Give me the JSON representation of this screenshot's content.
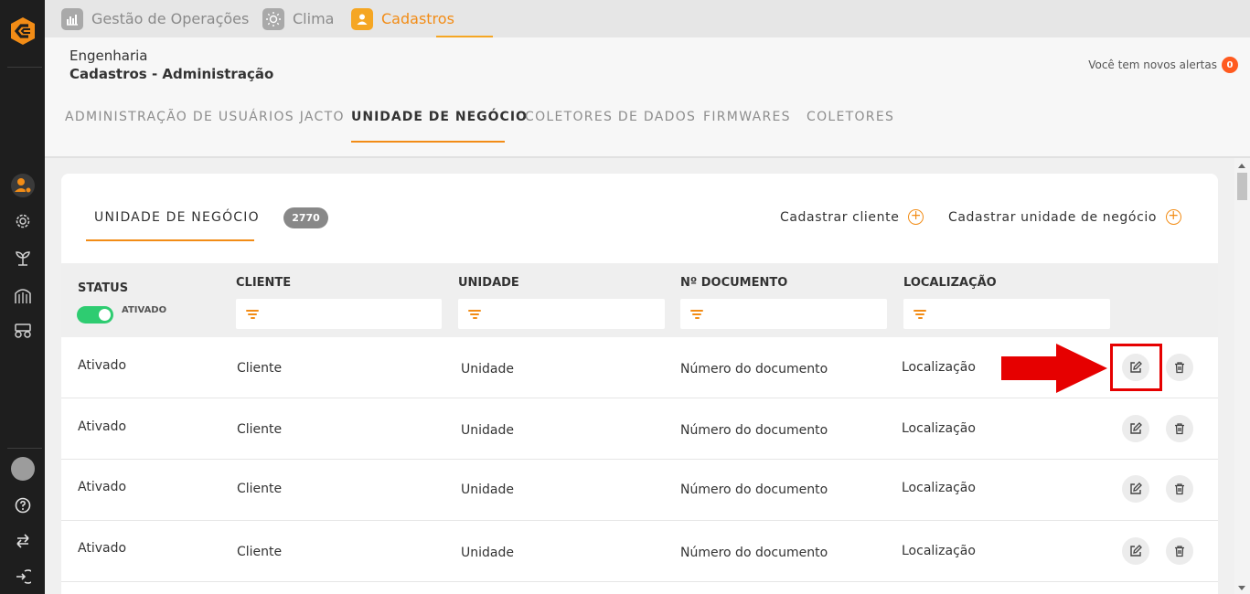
{
  "app_tabs": [
    {
      "label": "Gestão de Operações",
      "icon": "chart-icon"
    },
    {
      "label": "Clima",
      "icon": "sun-icon"
    },
    {
      "label": "Cadastros",
      "icon": "user-icon",
      "active": true
    }
  ],
  "header": {
    "department": "Engenharia",
    "title": "Cadastros - Administração",
    "alerts_text": "Você tem novos alertas",
    "alerts_count": "0"
  },
  "sub_tabs": [
    {
      "label": "ADMINISTRAÇÃO DE USUÁRIOS JACTO"
    },
    {
      "label": "UNIDADE DE NEGÓCIO",
      "active": true
    },
    {
      "label": "COLETORES DE DADOS"
    },
    {
      "label": "FIRMWARES"
    },
    {
      "label": "COLETORES"
    }
  ],
  "card": {
    "tab_label": "UNIDADE DE NEGÓCIO",
    "count": "2770",
    "add_client": "Cadastrar cliente",
    "add_unit": "Cadastrar unidade de negócio"
  },
  "table": {
    "columns": {
      "status": "STATUS",
      "client": "CLIENTE",
      "unit": "UNIDADE",
      "document": "Nº DOCUMENTO",
      "location": "LOCALIZAÇÃO"
    },
    "status_toggle_label": "ATIVADO",
    "rows": [
      {
        "status": "Ativado",
        "client": "Cliente",
        "unit": "Unidade",
        "document": "Número do documento",
        "location": "Localização"
      },
      {
        "status": "Ativado",
        "client": "Cliente",
        "unit": "Unidade",
        "document": "Número do documento",
        "location": "Localização"
      },
      {
        "status": "Ativado",
        "client": "Cliente",
        "unit": "Unidade",
        "document": "Número do documento",
        "location": "Localização"
      },
      {
        "status": "Ativado",
        "client": "Cliente",
        "unit": "Unidade",
        "document": "Número do documento",
        "location": "Localização"
      }
    ]
  },
  "colors": {
    "accent": "#f28c16",
    "toggle_on": "#2ecc71",
    "highlight": "#e60000",
    "sidebar": "#1e1e1e"
  }
}
